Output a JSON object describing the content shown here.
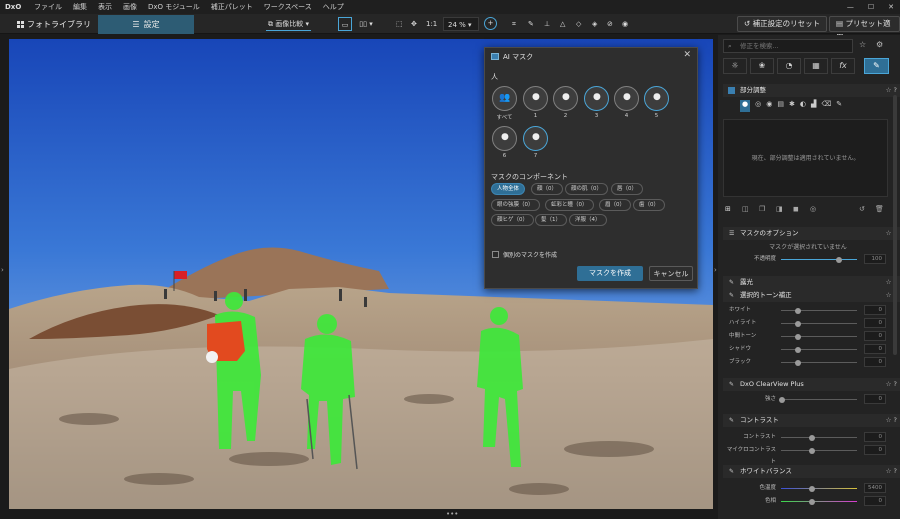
{
  "menubar": {
    "logo": "DxO",
    "items": [
      "ファイル",
      "編集",
      "表示",
      "画像",
      "DxO モジュール",
      "補正パレット",
      "ワークスペース",
      "ヘルプ"
    ],
    "window_controls": [
      "—",
      "☐",
      "✕"
    ]
  },
  "toolbar": {
    "tab_library": "フォトライブラリ",
    "tab_settings": "設定",
    "compare_label": "画像比較",
    "one_to_one": "1:1",
    "zoom_value": "24 %",
    "reset_button": "補正設定のリセット",
    "preset_button": "プリセット適用"
  },
  "dialog": {
    "title": "AI マスク",
    "close": "✕",
    "people_section": "人",
    "people": [
      "すべて",
      "1",
      "2",
      "3",
      "4",
      "5",
      "6",
      "7"
    ],
    "components_section": "マスクのコンポーネント",
    "components": [
      "人物全体",
      "顔（0）",
      "顔の肌（0）",
      "唇（0）",
      "眼の強膜（0）",
      "虹彩と瞳（0）",
      "眉（0）",
      "歯（0）",
      "顔ヒゲ（0）",
      "髪（1）",
      "洋服（4）"
    ],
    "checkbox_label": "個別のマスクを作成",
    "create_button": "マスクを作成",
    "cancel_button": "キャンセル"
  },
  "right_panel": {
    "search_placeholder": "修正を検索...",
    "local_adjust_title": "部分調整",
    "no_adjust_message": "現在、部分調整は適用されていません。",
    "mask_options_title": "マスクのオプション",
    "no_mask_selected": "マスクが選択されていません",
    "opacity_label": "不透明度",
    "opacity_value": "100",
    "exposure_title": "露光",
    "selective_tone_title": "選択的トーン補正",
    "tone_sliders": [
      {
        "label": "ホワイト",
        "value": "0"
      },
      {
        "label": "ハイライト",
        "value": "0"
      },
      {
        "label": "中間トーン",
        "value": "0"
      },
      {
        "label": "シャドウ",
        "value": "0"
      },
      {
        "label": "ブラック",
        "value": "0"
      }
    ],
    "clearview_title": "DxO ClearView Plus",
    "clearview_strength_label": "強さ",
    "clearview_value": "0",
    "contrast_title": "コントラスト",
    "contrast_sliders": [
      {
        "label": "コントラスト",
        "value": "0"
      },
      {
        "label": "マイクロコントラスト",
        "value": "0"
      }
    ],
    "wb_title": "ホワイトバランス",
    "wb_sliders": [
      {
        "label": "色温度",
        "value": "5400"
      },
      {
        "label": "色相",
        "value": "0"
      }
    ]
  },
  "colors": {
    "accent": "#2f6f96",
    "selected_ring": "#4aa6d8",
    "mask_green": "#3ee83a"
  }
}
